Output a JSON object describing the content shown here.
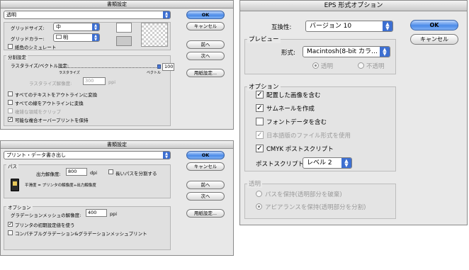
{
  "d1": {
    "title": "書類設定",
    "preset": "透明",
    "grid_size_label": "グリッドサイズ:",
    "grid_size": "中",
    "grid_color_label": "グリッドカラー:",
    "grid_color": "明",
    "simulate_paper": "紙色のシミュレート",
    "ok": "OK",
    "cancel": "キャンセル",
    "prev": "前へ",
    "next": "次へ",
    "paper_setup": "用紙設定...",
    "flatten_title": "分割設定",
    "raster_vector_label": "ラスタライズ/ベクトル設定:",
    "raster_label": "ラスタライズ",
    "vector_label": "ベクトル",
    "slider_value": "100",
    "slider_fraction": 1.0,
    "raster_res_label": "ラスタライズ解像度:",
    "raster_res": "300",
    "ppi": "ppi",
    "opt_text_outline": "すべてのテキストをアウトラインに変換",
    "opt_stroke_outline": "すべての線をアウトラインに変換",
    "opt_clip": "複雑な領域をクリップ",
    "opt_overprint": "可能な複合オーバープリントを保持"
  },
  "d2": {
    "title": "書類設定",
    "preset": "プリント・データ書き出し",
    "ok": "OK",
    "cancel": "キャンセル",
    "prev": "前へ",
    "next": "次へ",
    "paper_setup": "用紙設定...",
    "path_title": "パス",
    "output_res_label": "出力解像度:",
    "output_res": "800",
    "dpi": "dpi",
    "split_long_paths": "長いパスを分割する",
    "precision_note": "平滑度 = プリンタの解像度÷出力解像度",
    "options_title": "オプション",
    "mesh_res_label": "グラデーションメッシュの解像度:",
    "mesh_res": "400",
    "ppi": "ppi",
    "use_printer_default": "プリンタの初期設定値を使う",
    "compatible_gradient": "コンパチブルグラデーション&グラデーションメッシュプリント"
  },
  "d3": {
    "title": "EPS 形式オプション",
    "compat_label": "互換性:",
    "compat": "バージョン 10",
    "ok": "OK",
    "cancel": "キャンセル",
    "preview_title": "プレビュー",
    "format_label": "形式:",
    "format": "Macintosh(8-bit カラ…",
    "transparent": "透明",
    "opaque": "不透明",
    "options_title": "オプション",
    "opt_include_linked": "配置した画像を含む",
    "opt_thumbnails": "サムネールを作成",
    "opt_fonts": "フォントデータを含む",
    "opt_japanese_format": "日本語版のファイル形式を使用",
    "opt_cmyk_ps": "CMYK ポストスクリプト",
    "ps_label": "ポストスクリプト:",
    "ps_level": "レベル 2",
    "transparency_title": "透明",
    "preserve_paths": "パスを保持(透明部分を破棄)",
    "preserve_appearance": "アピアランスを保持(透明部分を分割)"
  }
}
